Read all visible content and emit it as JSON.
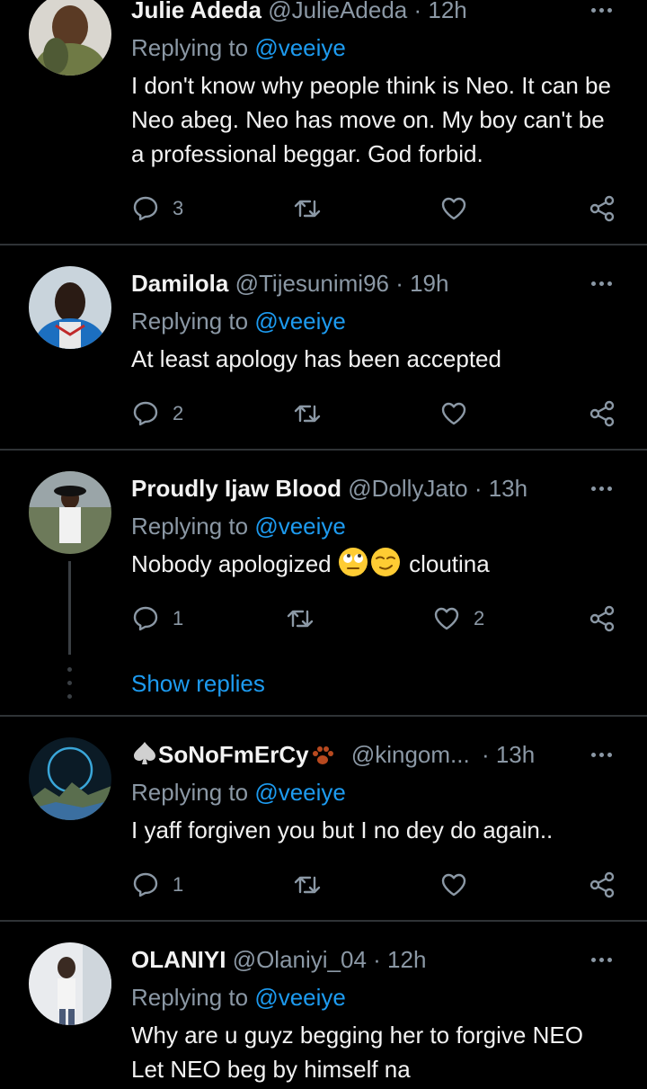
{
  "tweets": [
    {
      "name": "Julie Adeda",
      "handle": "@JulieAdeda",
      "time": "· 12h",
      "replying_label": "Replying to",
      "replying_to": "@veeiye",
      "text": "I don't know why people think is Neo. It can be Neo abeg. Neo has move on. My boy can't be a professional beggar. God forbid.",
      "replies": "3",
      "retweets": "",
      "likes": ""
    },
    {
      "name": "Damilola",
      "handle": "@Tijesunimi96",
      "time": "· 19h",
      "replying_label": "Replying to",
      "replying_to": "@veeiye",
      "text": "At least apology has been accepted",
      "replies": "2",
      "retweets": "",
      "likes": ""
    },
    {
      "name": "Proudly Ijaw Blood",
      "handle": "@DollyJato",
      "time": "· 13h",
      "replying_label": "Replying to",
      "replying_to": "@veeiye",
      "text_before": "Nobody apologized",
      "text_after": "cloutina",
      "replies": "1",
      "retweets": "",
      "likes": "2",
      "show_replies": "Show replies"
    },
    {
      "name": "SoNoFmErCy",
      "handle": "@kingom...",
      "time": "· 13h",
      "replying_label": "Replying to",
      "replying_to": "@veeiye",
      "text": "I yaff forgiven you but I no dey do again..",
      "replies": "1",
      "retweets": "",
      "likes": ""
    },
    {
      "name": "OLANIYI",
      "handle": "@Olaniyi_04",
      "time": "· 12h",
      "replying_label": "Replying to",
      "replying_to": "@veeiye",
      "text": "Why are u guyz begging her to forgive NEO Let NEO beg by himself na"
    }
  ],
  "icons": [
    "reply-icon",
    "retweet-icon",
    "like-icon",
    "share-icon",
    "more-icon",
    "spade-icon",
    "paw-icon",
    "face-rolling-eyes-icon",
    "smirk-icon"
  ],
  "colors": {
    "background": "#000000",
    "text": "#f2f2f2",
    "muted": "#8b98a5",
    "link": "#1d9bf0",
    "divider": "#2f3336"
  }
}
